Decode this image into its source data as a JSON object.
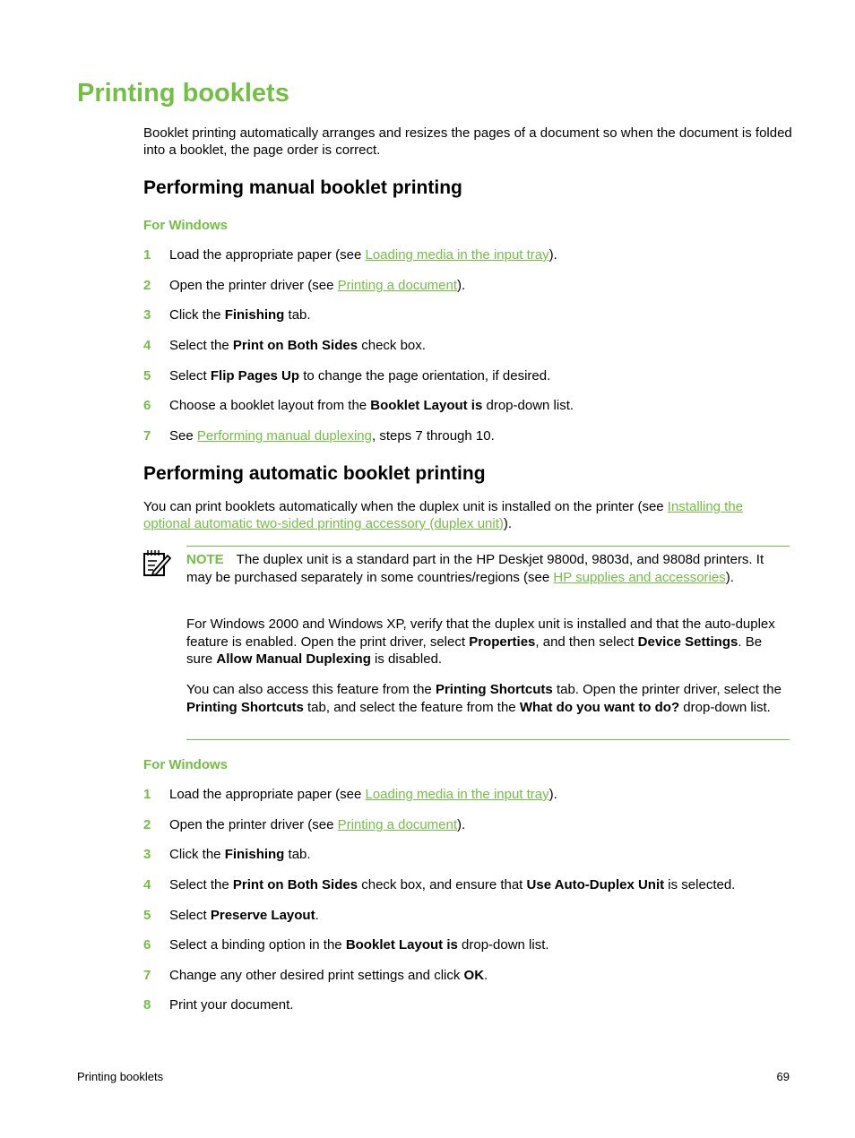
{
  "page_title": "Printing booklets",
  "intro": "Booklet printing automatically arranges and resizes the pages of a document so when the document is folded into a booklet, the page order is correct.",
  "manual": {
    "heading": "Performing manual booklet printing",
    "subheading": "For Windows",
    "steps": [
      {
        "num": "1",
        "pre": "Load the appropriate paper (see ",
        "link": "Loading media in the input tray",
        "post": ")."
      },
      {
        "num": "2",
        "pre": "Open the printer driver (see ",
        "link": "Printing a document",
        "post": ")."
      },
      {
        "num": "3",
        "pre": "Click the ",
        "bold": "Finishing",
        "post": " tab."
      },
      {
        "num": "4",
        "pre": "Select the ",
        "bold": "Print on Both Sides",
        "post": " check box."
      },
      {
        "num": "5",
        "pre": "Select ",
        "bold": "Flip Pages Up",
        "post": " to change the page orientation, if desired."
      },
      {
        "num": "6",
        "pre": "Choose a booklet layout from the ",
        "bold": "Booklet Layout is",
        "post": " drop-down list."
      },
      {
        "num": "7",
        "pre": "See ",
        "link": "Performing manual duplexing",
        "post": ", steps 7 through 10."
      }
    ]
  },
  "automatic": {
    "heading": "Performing automatic booklet printing",
    "intro_pre": "You can print booklets automatically when the duplex unit is installed on the printer (see ",
    "intro_link": "Installing the optional automatic two-sided printing accessory (duplex unit)",
    "intro_post": ").",
    "note": {
      "icon": "note-pencil-icon",
      "label": "NOTE",
      "p1_pre": "The duplex unit is a standard part in the HP Deskjet 9800d, 9803d, and 9808d printers. It may be purchased separately in some countries/regions (see ",
      "p1_link": "HP supplies and accessories",
      "p1_post": ").",
      "p2": {
        "t1": "For Windows 2000 and Windows XP, verify that the duplex unit is installed and that the auto-duplex feature is enabled. Open the print driver, select ",
        "b1": "Properties",
        "t2": ", and then select ",
        "b2": "Device Settings",
        "t3": ". Be sure ",
        "b3": "Allow Manual Duplexing",
        "t4": " is disabled."
      },
      "p3": {
        "t1": "You can also access this feature from the ",
        "b1": "Printing Shortcuts",
        "t2": " tab. Open the printer driver, select the ",
        "b2": "Printing Shortcuts",
        "t3": " tab, and select the feature from the ",
        "b3": "What do you want to do?",
        "t4": " drop-down list."
      }
    },
    "subheading": "For Windows",
    "steps": [
      {
        "num": "1",
        "pre": "Load the appropriate paper (see ",
        "link": "Loading media in the input tray",
        "post": ")."
      },
      {
        "num": "2",
        "pre": "Open the printer driver (see ",
        "link": "Printing a document",
        "post": ")."
      },
      {
        "num": "3",
        "pre": "Click the ",
        "bold": "Finishing",
        "post": " tab."
      },
      {
        "num": "4",
        "pre": "Select the ",
        "bold": "Print on Both Sides",
        "mid": " check box, and ensure that ",
        "bold2": "Use Auto-Duplex Unit",
        "post": " is selected."
      },
      {
        "num": "5",
        "pre": "Select ",
        "bold": "Preserve Layout",
        "post": "."
      },
      {
        "num": "6",
        "pre": "Select a binding option in the ",
        "bold": "Booklet Layout is",
        "post": " drop-down list."
      },
      {
        "num": "7",
        "pre": "Change any other desired print settings and click ",
        "bold": "OK",
        "post": "."
      },
      {
        "num": "8",
        "pre": "Print your document.",
        "post": ""
      }
    ]
  },
  "footer": {
    "section": "Printing booklets",
    "page_number": "69"
  },
  "colors": {
    "accent": "#73bf44",
    "text": "#000000"
  }
}
